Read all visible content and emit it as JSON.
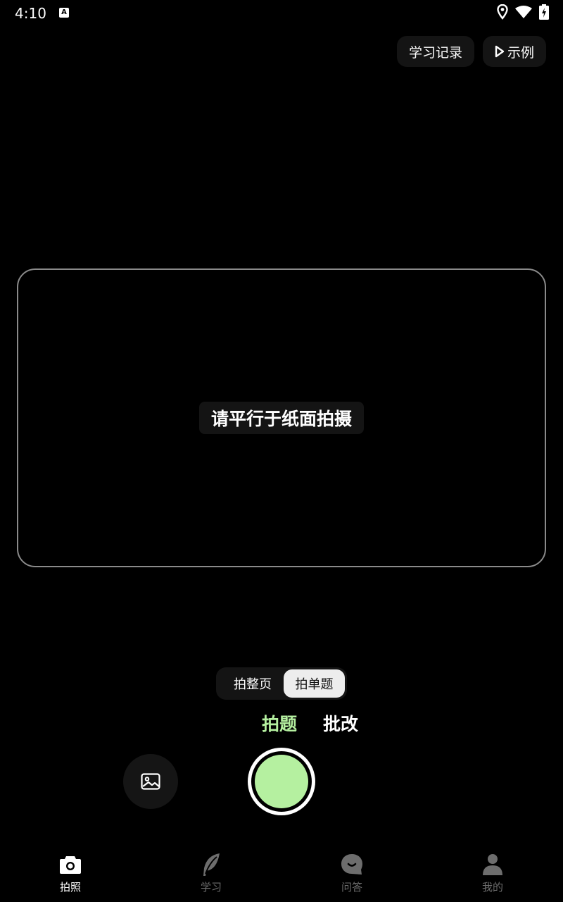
{
  "status_bar": {
    "time": "4:10",
    "a_badge": "A",
    "icons": [
      "location-icon",
      "wifi-icon",
      "battery-charging-icon"
    ]
  },
  "top_actions": {
    "history_label": "学习记录",
    "example_label": "示例",
    "example_icon": "play-icon"
  },
  "camera": {
    "hint": "请平行于纸面拍摄"
  },
  "segment": {
    "options": [
      "拍整页",
      "拍单题"
    ],
    "selected": "拍单题"
  },
  "modes": {
    "items": [
      "拍题",
      "批改"
    ],
    "active": "拍题",
    "active_color": "#b5f0a0"
  },
  "capture": {
    "gallery_icon": "image-icon",
    "shutter_color": "#b5f0a0"
  },
  "bottom_nav": {
    "items": [
      {
        "label": "拍照",
        "icon": "camera-icon",
        "active": true
      },
      {
        "label": "学习",
        "icon": "feather-icon",
        "active": false
      },
      {
        "label": "问答",
        "icon": "chat-icon",
        "active": false
      },
      {
        "label": "我的",
        "icon": "user-icon",
        "active": false
      }
    ]
  }
}
